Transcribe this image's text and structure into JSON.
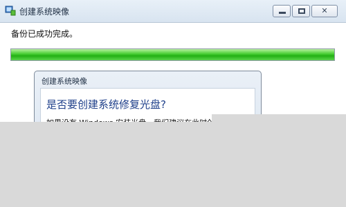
{
  "window": {
    "title": "创建系统映像",
    "status_text": "备份已成功完成。",
    "progress_fraction": 1.0
  },
  "dialog": {
    "title": "创建系统映像",
    "heading": "是否要创建系统修复光盘?",
    "body_text": "如果没有 Windows 安装光盘，我们建议在此时创建..."
  },
  "colors": {
    "progress": "#2fbd1f",
    "heading": "#1e3f8a",
    "background": "#d9d9d9"
  },
  "icons": {
    "app_icon": "backup-app-icon",
    "minimize": "minimize-icon",
    "maximize": "maximize-icon",
    "close": "close-icon"
  }
}
